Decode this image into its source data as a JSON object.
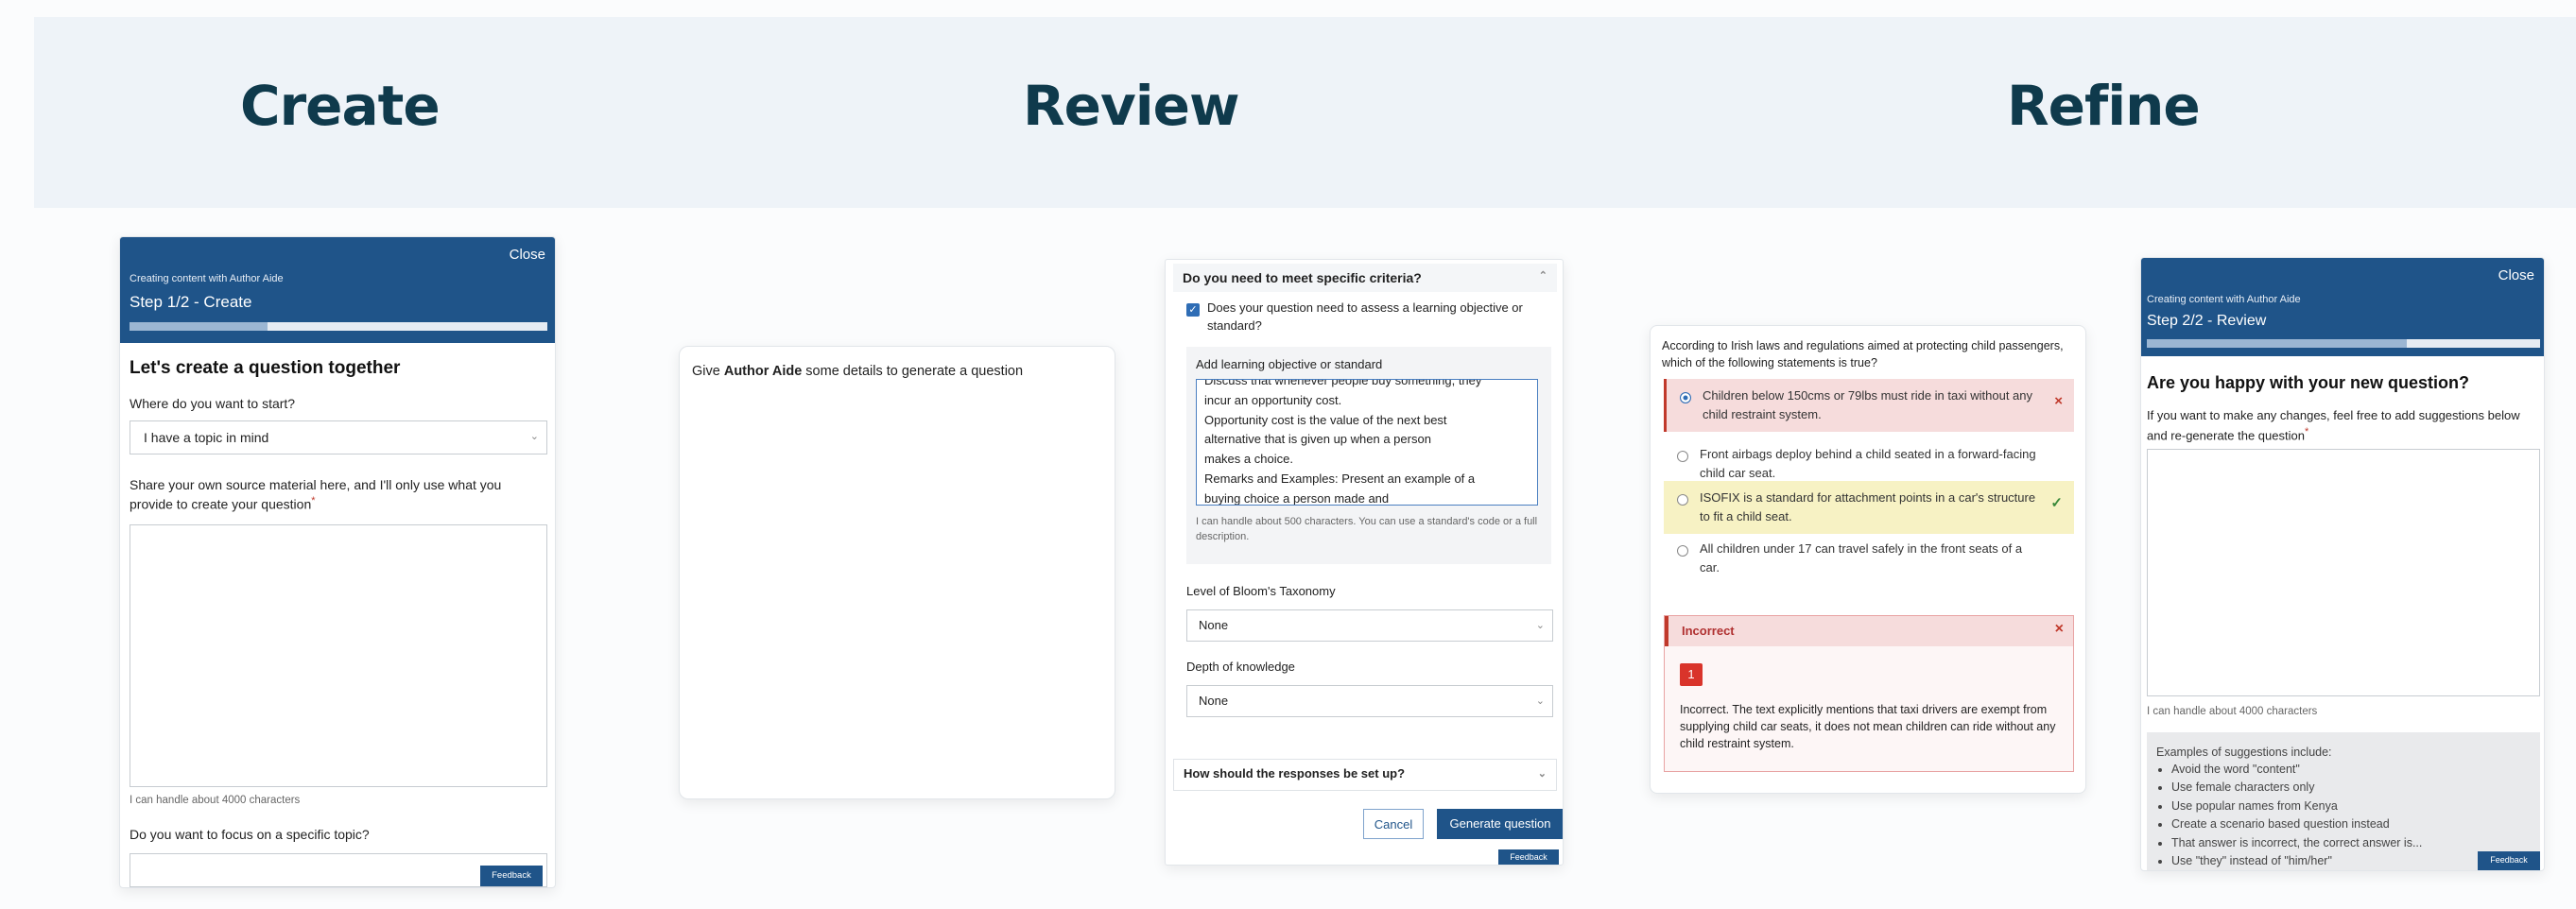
{
  "stages": {
    "create": "Create",
    "review": "Review",
    "refine": "Refine"
  },
  "create_panel": {
    "close": "Close",
    "caption": "Creating content with Author Aide",
    "step": "Step 1/2 - Create",
    "progress": 0.33,
    "heading": "Let's create a question together",
    "start_label": "Where do you want to start?",
    "start_value": "I have a topic in mind",
    "source_label": "Share your own source material here, and I'll only use what you provide to create your question",
    "required_mark": "*",
    "char_limit": "I can handle about 4000 characters",
    "topic_label": "Do you want to focus on a specific topic?",
    "feedback": "Feedback"
  },
  "review_panel": {
    "prefix": "Give ",
    "brand": "Author Aide",
    "suffix": " some details to generate a question"
  },
  "criteria_panel": {
    "section_title": "Do you need to meet specific criteria?",
    "checkbox_label": "Does your question need to assess a learning objective or standard?",
    "objective_label": "Add learning objective or standard",
    "objective_lines": [
      "Discuss that whenever people buy something, they",
      "incur an opportunity cost.",
      "Opportunity cost is the value of the next best",
      "alternative that is given up when a person",
      "makes a choice.",
      "Remarks and Examples: Present an example of a",
      "buying choice a person made and"
    ],
    "objective_hint": "I can handle about 500 characters. You can use a standard's code or a full description.",
    "bloom_label": "Level of Bloom's Taxonomy",
    "bloom_value": "None",
    "depth_label": "Depth of knowledge",
    "depth_value": "None",
    "responses_title": "How should the responses be set up?",
    "cancel": "Cancel",
    "generate": "Generate question",
    "feedback": "Feedback"
  },
  "question_panel": {
    "stem": "According to Irish laws and regulations aimed at protecting child passengers, which of the following statements is true?",
    "options": [
      {
        "text": "Children below 150cms or 79lbs must ride in taxi without any child restraint system.",
        "state": "incorrect",
        "mark": "×"
      },
      {
        "text": "Front airbags deploy behind a child seated in a forward-facing child car seat.",
        "state": "none",
        "mark": ""
      },
      {
        "text": "ISOFIX is a standard for attachment points in a car's structure to fit a child seat.",
        "state": "correct",
        "mark": "✓"
      },
      {
        "text": "All children under 17 can travel safely in the front seats of a car.",
        "state": "none",
        "mark": ""
      }
    ],
    "feedback_title": "Incorrect",
    "feedback_close": "×",
    "feedback_badge": "1",
    "feedback_text": "Incorrect. The text explicitly mentions that taxi drivers are exempt from supplying child car seats, it does not mean children can ride without any child restraint system."
  },
  "refine_panel": {
    "close": "Close",
    "caption": "Creating content with Author Aide",
    "step": "Step 2/2 - Review",
    "progress": 0.66,
    "heading": "Are you happy with your new question?",
    "intro": "If you want to make any changes, feel free to add suggestions below and re-generate the question",
    "required_mark": "*",
    "char_limit": "I can handle about 4000 characters",
    "examples_title": "Examples of suggestions include:",
    "examples": [
      "Avoid the word \"content\"",
      "Use female characters only",
      "Use popular names from Kenya",
      "Create a scenario based question instead",
      "That answer is incorrect, the correct answer is...",
      "Use \"they\" instead of \"him/her\""
    ],
    "feedback": "Feedback"
  },
  "colors": {
    "brand_blue": "#1f5489",
    "title_teal": "#0f3a4c",
    "incorrect_bg": "#f6dcdc",
    "correct_bg": "#f7f2c4",
    "banner_bg": "#eef3f8"
  }
}
